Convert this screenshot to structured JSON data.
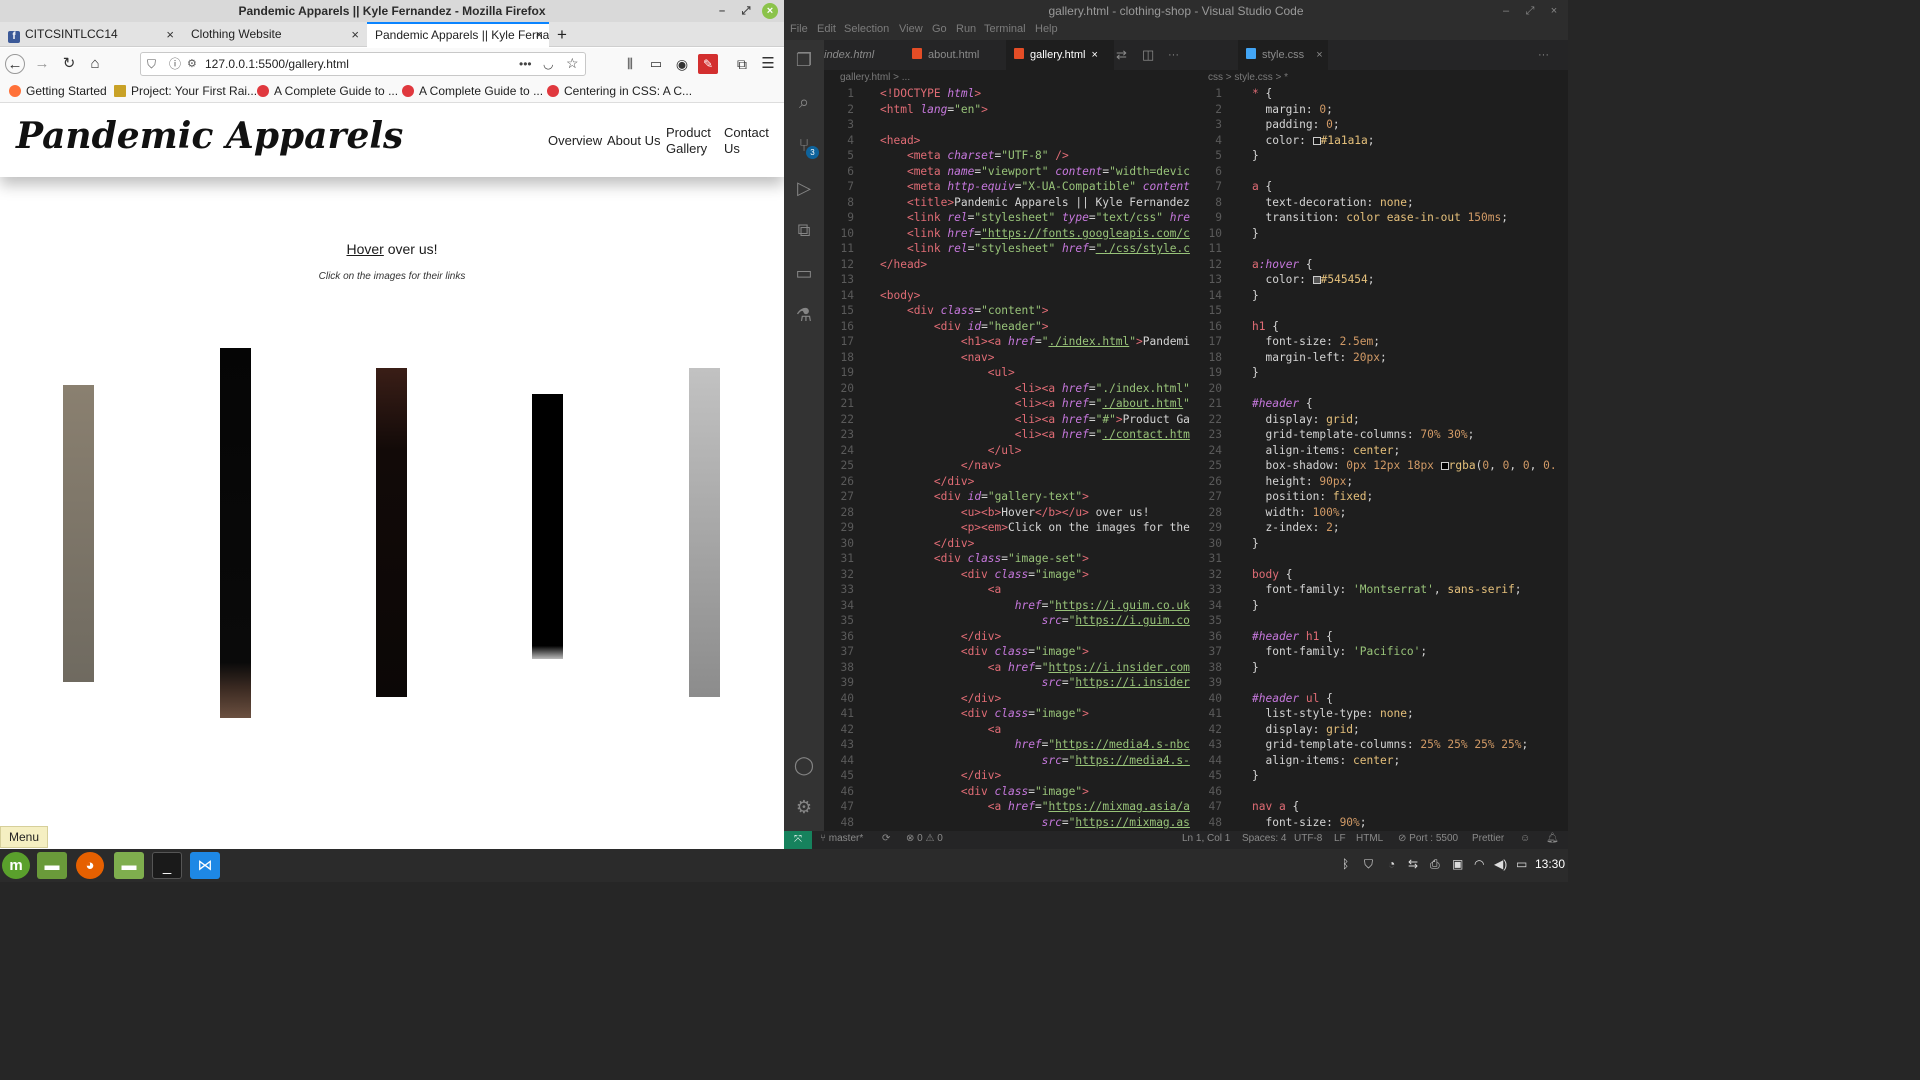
{
  "firefox": {
    "window_title": "Pandemic Apparels || Kyle Fernandez - Mozilla Firefox",
    "tabs": [
      {
        "label": "CITCSINTLCC14"
      },
      {
        "label": "Clothing Website"
      },
      {
        "label": "Pandemic Apparels || Kyle Ferna"
      }
    ],
    "new_tab": "+",
    "url": "127.0.0.1:5500/gallery.html",
    "url_more": "•••",
    "bookmarks": [
      {
        "label": "Getting Started"
      },
      {
        "label": "Project: Your First Rai..."
      },
      {
        "label": "A Complete Guide to ..."
      },
      {
        "label": "A Complete Guide to ..."
      },
      {
        "label": "Centering in CSS: A C..."
      }
    ],
    "page": {
      "logo": "Pandemic Apparels",
      "nav": [
        "Overview",
        "About Us",
        "Product Gallery",
        "Contact Us"
      ],
      "gallery_heading_bold": "Hover",
      "gallery_heading_rest": " over us!",
      "gallery_sub": "Click on the images for their links"
    },
    "menu_label": "Menu"
  },
  "vscode": {
    "window_title": "gallery.html - clothing-shop - Visual Studio Code",
    "menu": [
      "File",
      "Edit",
      "Selection",
      "View",
      "Go",
      "Run",
      "Terminal",
      "Help"
    ],
    "scm_badge": "3",
    "tabs": [
      {
        "label": "index.html"
      },
      {
        "label": "about.html"
      },
      {
        "label": "gallery.html"
      },
      {
        "label": "style.css"
      }
    ],
    "breadcrumb_left": "gallery.html > ...",
    "breadcrumb_right": "css > style.css > *",
    "status": {
      "branch": "master*",
      "errors": "⊗ 0 ⚠ 0",
      "position": "Ln 1, Col 1",
      "spaces": "Spaces: 4",
      "encoding": "UTF-8",
      "eol": "LF",
      "language": "HTML",
      "port": "Port : 5500",
      "formatter": "Prettier"
    }
  },
  "taskbar": {
    "clock": "13:30"
  }
}
